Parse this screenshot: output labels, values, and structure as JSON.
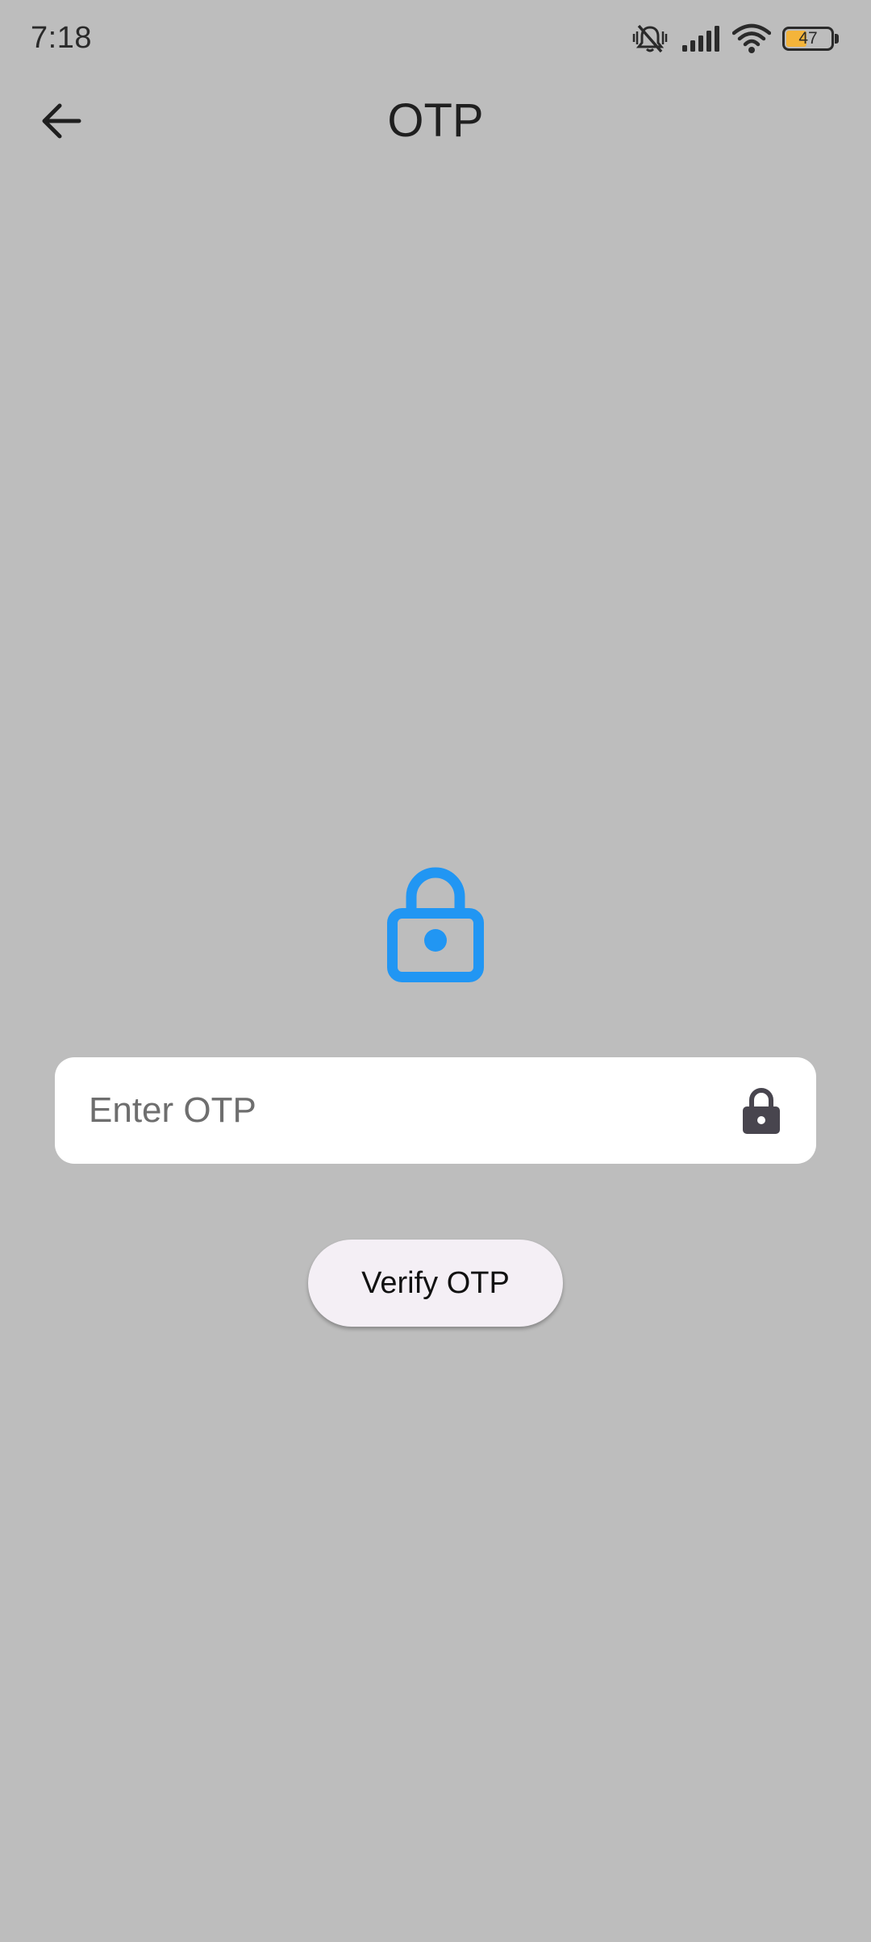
{
  "status_bar": {
    "time": "7:18",
    "battery_level": "47",
    "battery_fraction": 0.47,
    "icons": [
      "vibrate-mute-icon",
      "signal-icon",
      "wifi-icon",
      "battery-icon"
    ]
  },
  "app_bar": {
    "title": "OTP",
    "back_icon": "arrow-back-icon"
  },
  "hero": {
    "icon": "lock-outline-icon",
    "color": "#2196f3"
  },
  "otp_input": {
    "placeholder": "Enter OTP",
    "value": "",
    "suffix_icon": "lock-icon"
  },
  "verify_button": {
    "label": "Verify OTP"
  },
  "colors": {
    "background": "#bdbdbd",
    "accent": "#2196f3",
    "battery": "#f4b43a",
    "button_bg": "#f4eff5"
  }
}
